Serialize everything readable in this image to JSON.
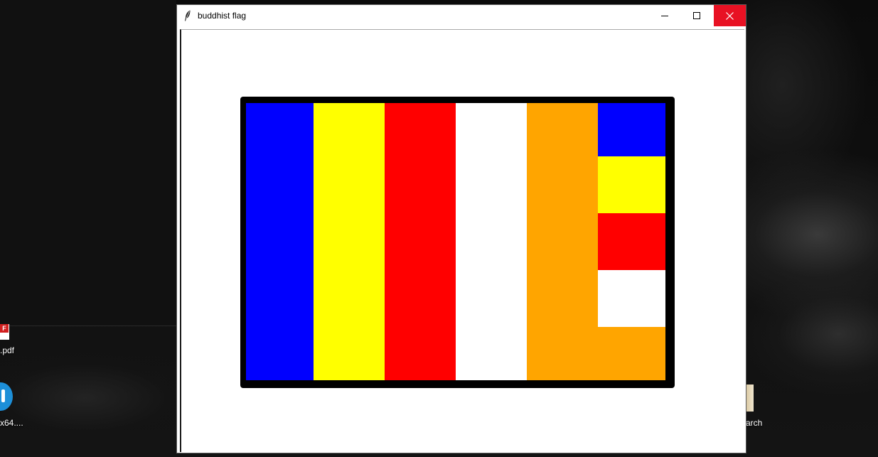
{
  "desktop": {
    "icons": [
      {
        "label": ".pdf",
        "icon": "pdf-file-icon",
        "badge": "F"
      },
      {
        "label": "x64....",
        "icon": "installer-app-icon"
      },
      {
        "label": "arch",
        "icon": "search-shortcut-icon"
      }
    ]
  },
  "window": {
    "title": "buddhist flag",
    "app_icon": "feather-icon",
    "controls": {
      "minimize": "minimize-icon",
      "maximize": "maximize-icon",
      "close": "close-icon"
    },
    "close_hover_color": "#e81123"
  },
  "flag": {
    "border_color": "#000000",
    "vertical_stripes": [
      {
        "name": "blue",
        "color": "#0000ff"
      },
      {
        "name": "yellow",
        "color": "#ffff00"
      },
      {
        "name": "red",
        "color": "#ff0000"
      },
      {
        "name": "white",
        "color": "#ffffff"
      },
      {
        "name": "orange",
        "color": "#ffa500"
      }
    ],
    "mixed_column": [
      {
        "name": "blue",
        "color": "#0000ff"
      },
      {
        "name": "yellow",
        "color": "#ffff00"
      },
      {
        "name": "red",
        "color": "#ff0000"
      },
      {
        "name": "white",
        "color": "#ffffff"
      },
      {
        "name": "orange",
        "color": "#ffa500"
      }
    ]
  }
}
